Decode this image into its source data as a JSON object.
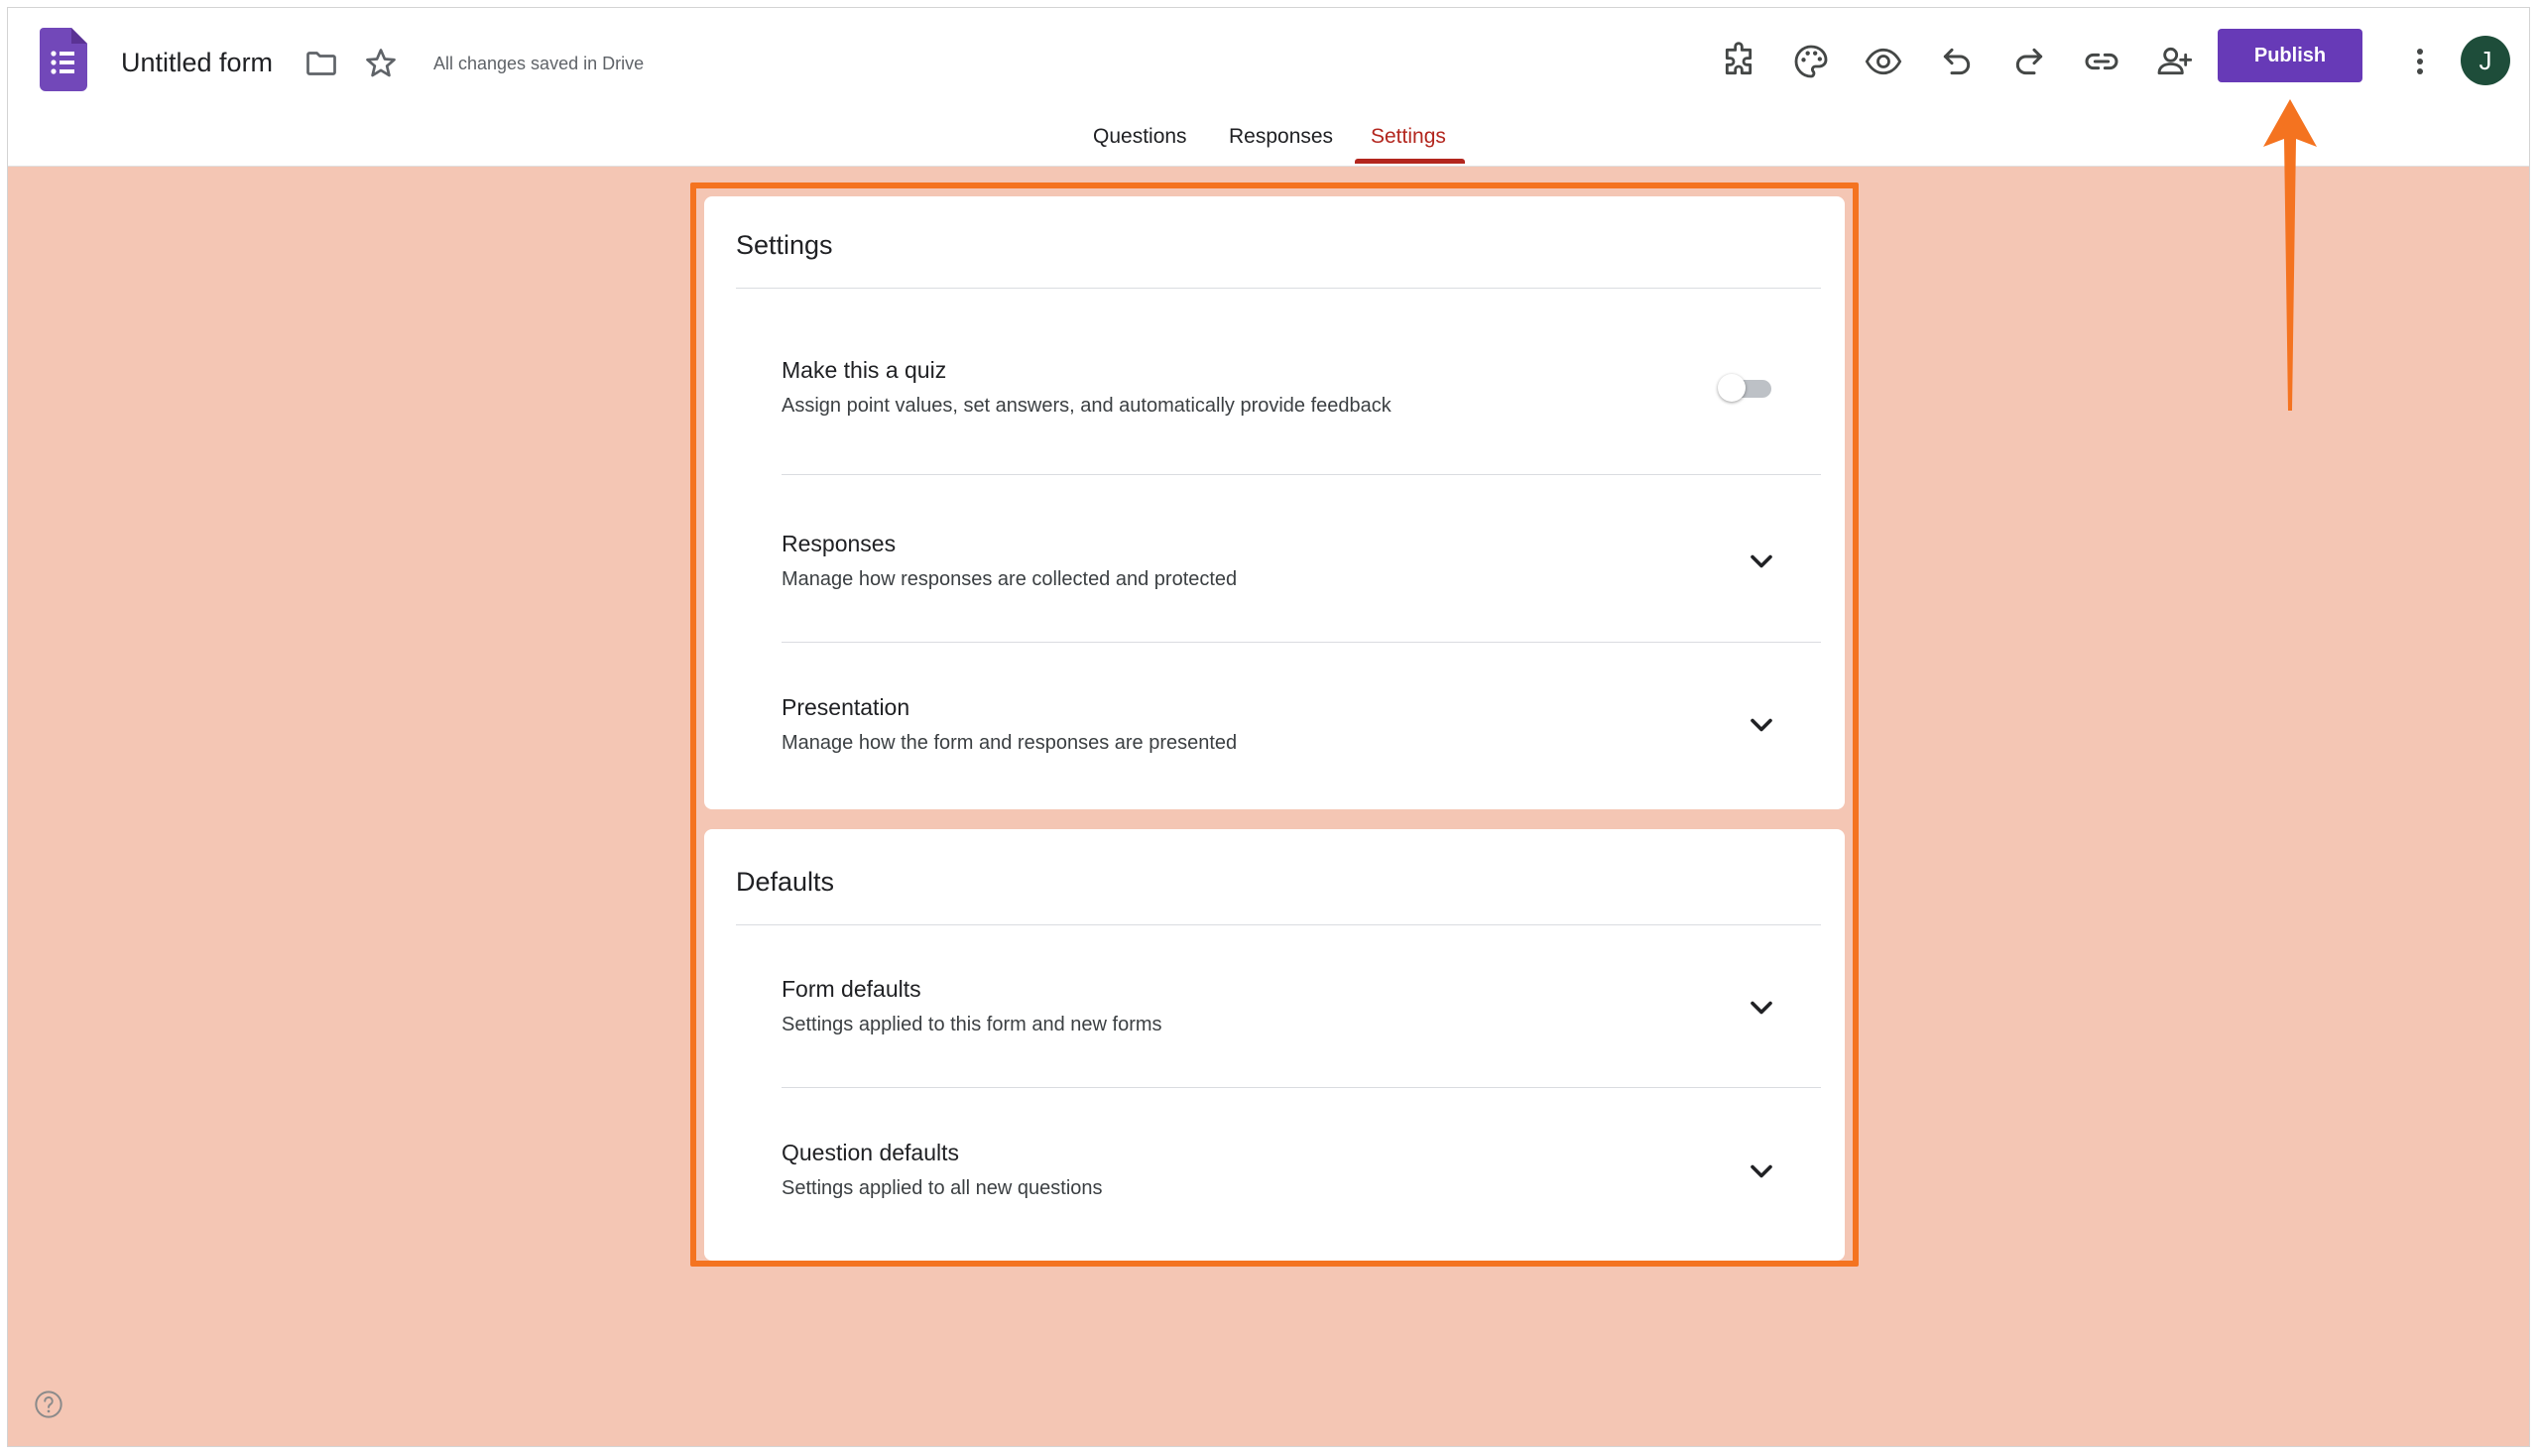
{
  "header": {
    "form_title": "Untitled form",
    "save_status": "All changes saved in Drive",
    "publish_label": "Publish",
    "avatar_initial": "J"
  },
  "tabs": [
    {
      "label": "Questions"
    },
    {
      "label": "Responses"
    },
    {
      "label": "Settings",
      "active": true
    }
  ],
  "settings_card": {
    "title": "Settings",
    "rows": [
      {
        "title": "Make this a quiz",
        "description": "Assign point values, set answers, and automatically provide feedback",
        "control": "toggle",
        "on": false
      },
      {
        "title": "Responses",
        "description": "Manage how responses are collected and protected",
        "control": "chevron"
      },
      {
        "title": "Presentation",
        "description": "Manage how the form and responses are presented",
        "control": "chevron"
      }
    ]
  },
  "defaults_card": {
    "title": "Defaults",
    "rows": [
      {
        "title": "Form defaults",
        "description": "Settings applied to this form and new forms",
        "control": "chevron"
      },
      {
        "title": "Question defaults",
        "description": "Settings applied to all new questions",
        "control": "chevron"
      }
    ]
  },
  "colors": {
    "accent": "#673ab7",
    "active_tab": "#b3261e",
    "background": "#f4c6b4",
    "highlight": "#f47320"
  },
  "icons": {
    "toolbar": [
      "addon-puzzle-icon",
      "palette-icon",
      "preview-eye-icon",
      "undo-icon",
      "redo-icon",
      "link-icon",
      "add-collaborator-icon"
    ],
    "other": [
      "forms-logo-icon",
      "folder-icon",
      "star-icon",
      "more-vert-icon",
      "help-icon",
      "chevron-down-icon"
    ]
  }
}
